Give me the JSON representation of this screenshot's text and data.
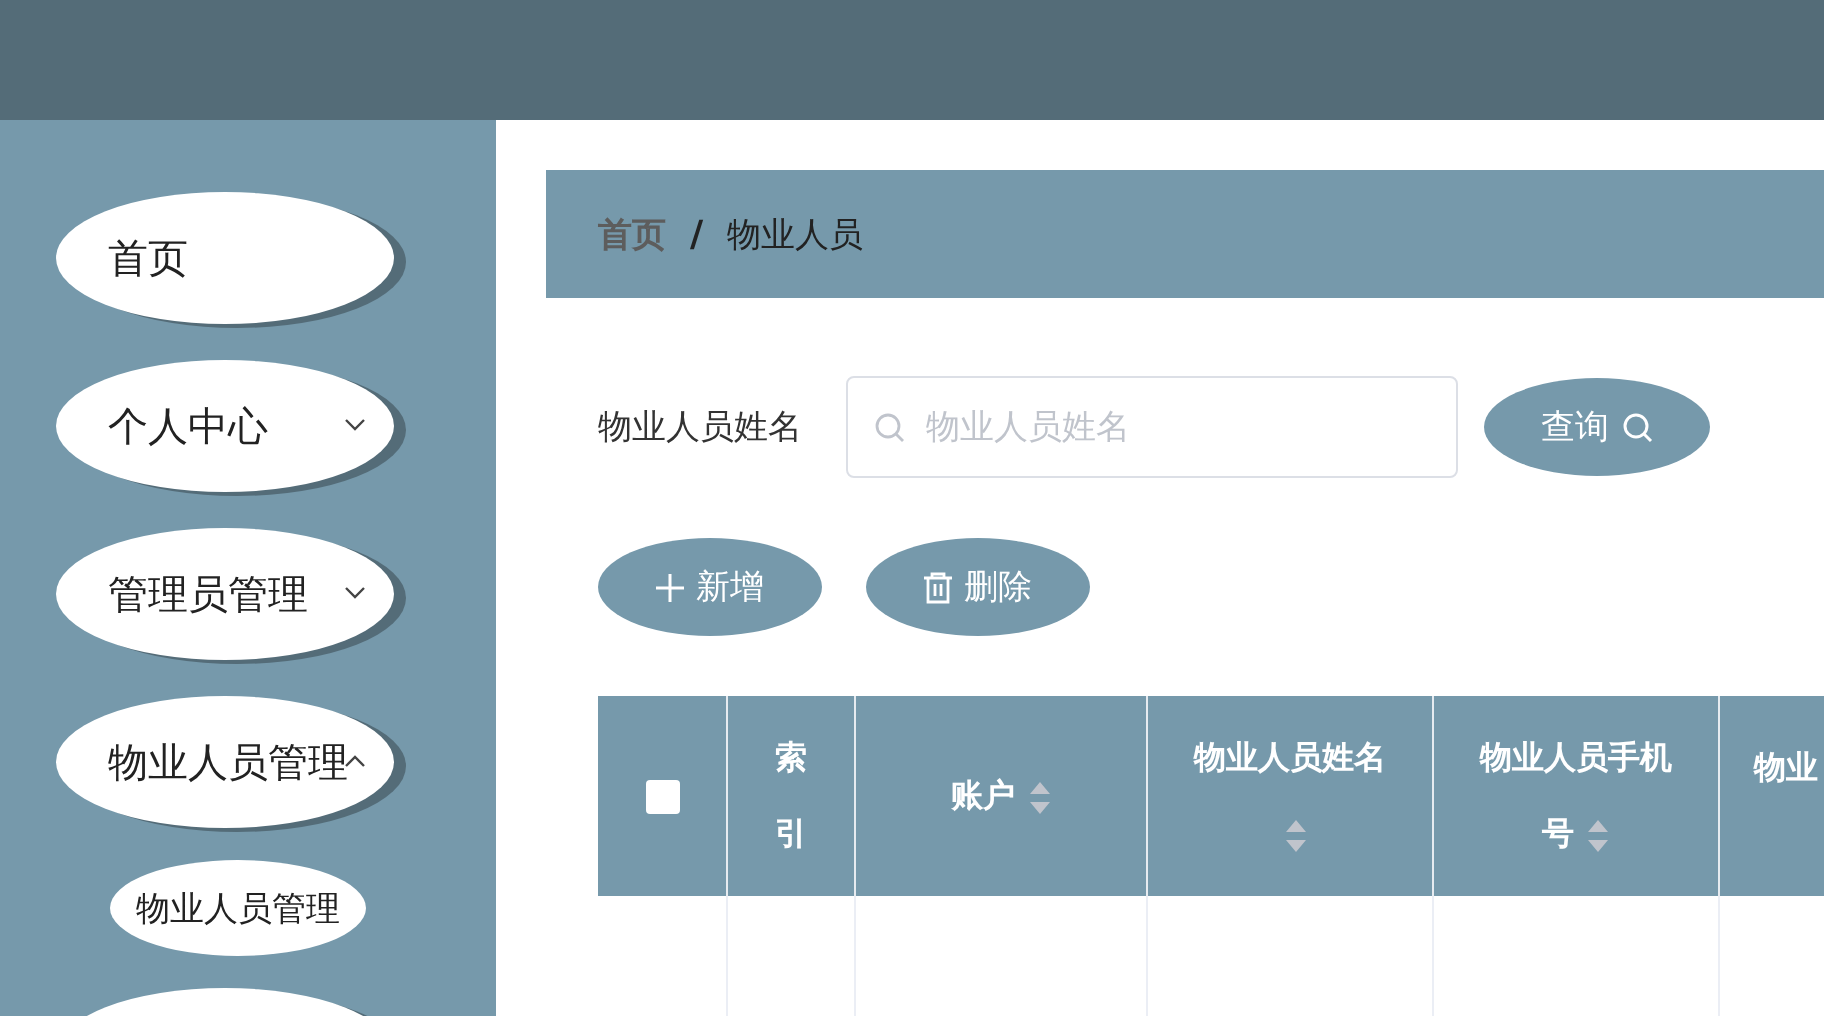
{
  "sidebar": {
    "items": [
      {
        "label": "首页",
        "kind": "link"
      },
      {
        "label": "个人中心",
        "kind": "submenu",
        "expanded": false
      },
      {
        "label": "管理员管理",
        "kind": "submenu",
        "expanded": false
      },
      {
        "label": "物业人员管理",
        "kind": "submenu",
        "expanded": true,
        "children": [
          {
            "label": "物业人员管理"
          }
        ]
      },
      {
        "kind": "cut"
      }
    ]
  },
  "breadcrumb": {
    "separator": "/",
    "items": [
      "首页",
      "物业人员"
    ]
  },
  "search": {
    "label": "物业人员姓名",
    "placeholder": "物业人员姓名",
    "button": "查询"
  },
  "actions": [
    {
      "label": "新增",
      "kind": "add"
    },
    {
      "label": "删除",
      "kind": "delete"
    }
  ],
  "table": {
    "select_all": {
      "checked": false
    },
    "columns": [
      {
        "label": "索引",
        "sortable": false
      },
      {
        "label": "账户",
        "sortable": true
      },
      {
        "label": "物业人员姓名",
        "sortable": true
      },
      {
        "label": "物业人员手机号",
        "sortable": true
      },
      {
        "label": "物业",
        "sortable": false
      }
    ]
  }
}
